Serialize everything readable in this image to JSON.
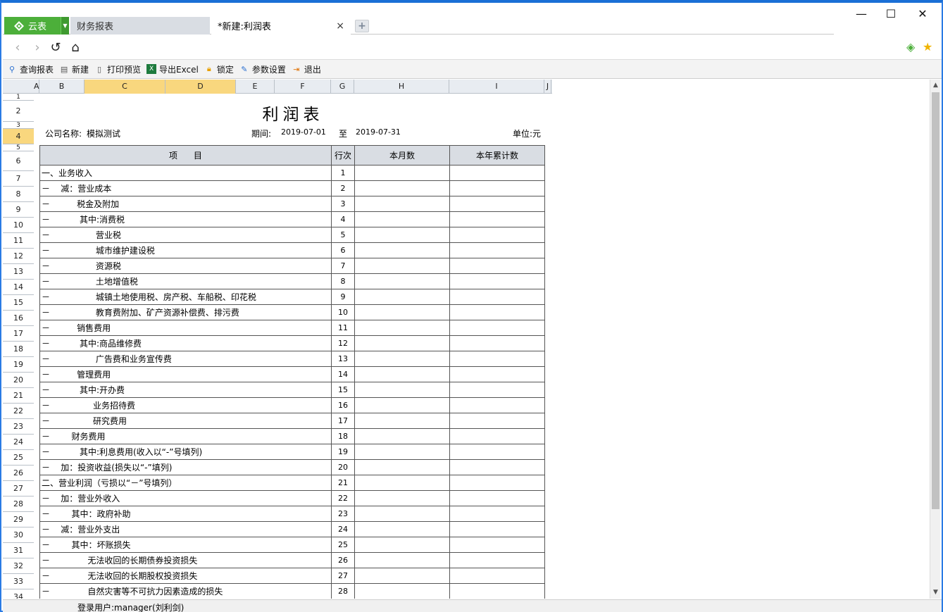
{
  "tabs": {
    "app_label": "云表",
    "tab1": "财务报表",
    "tab2": "*新建:利润表",
    "close": "×",
    "new_tab": "+"
  },
  "window": {
    "minimize": "—",
    "maximize": "☐",
    "close": "✕"
  },
  "toolbar": {
    "query": "查询报表",
    "new": "新建",
    "print_preview": "打印预览",
    "export": "导出Excel",
    "lock": "锁定",
    "params": "参数设置",
    "exit": "退出"
  },
  "columns": [
    "A",
    "B",
    "C",
    "D",
    "E",
    "F",
    "G",
    "H",
    "I",
    "J"
  ],
  "row_numbers": [
    "1",
    "2",
    "3",
    "4",
    "5",
    "6",
    "7",
    "8",
    "9",
    "10",
    "11",
    "12",
    "13",
    "14",
    "15",
    "16",
    "17",
    "18",
    "19",
    "20",
    "21",
    "22",
    "23",
    "24",
    "25",
    "26",
    "27",
    "28",
    "29",
    "30",
    "31",
    "32",
    "33",
    "34"
  ],
  "report": {
    "title": "利润表",
    "company_label": "公司名称:",
    "company": "模拟测试",
    "period_label": "期间:",
    "period_start": "2019-07-01",
    "to": "至",
    "period_end": "2019-07-31",
    "unit": "单位:元",
    "headers": {
      "item": "项      目",
      "line": "行次",
      "month": "本月数",
      "ytd": "本年累计数"
    },
    "rows": [
      {
        "item": "一、业务收入",
        "line": "1"
      },
      {
        "item": "－    减：营业成本",
        "line": "2"
      },
      {
        "item": "－          税金及附加",
        "line": "3"
      },
      {
        "item": "－           其中:消费税",
        "line": "4"
      },
      {
        "item": "－                 营业税",
        "line": "5"
      },
      {
        "item": "－                 城市维护建设税",
        "line": "6"
      },
      {
        "item": "－                 资源税",
        "line": "7"
      },
      {
        "item": "－                 土地增值税",
        "line": "8"
      },
      {
        "item": "－                 城镇土地使用税、房产税、车船税、印花税",
        "line": "9"
      },
      {
        "item": "－                 教育费附加、矿产资源补偿费、排污费",
        "line": "10"
      },
      {
        "item": "－          销售费用",
        "line": "11"
      },
      {
        "item": "－           其中:商品维修费",
        "line": "12"
      },
      {
        "item": "－                 广告费和业务宣传费",
        "line": "13"
      },
      {
        "item": "－          管理费用",
        "line": "14"
      },
      {
        "item": "－           其中:开办费",
        "line": "15"
      },
      {
        "item": "－                业务招待费",
        "line": "16"
      },
      {
        "item": "－                研究费用",
        "line": "17"
      },
      {
        "item": "－        财务费用",
        "line": "18"
      },
      {
        "item": "－           其中:利息费用(收入以“-”号填列)",
        "line": "19"
      },
      {
        "item": "－    加：投资收益(损失以“-”填列)",
        "line": "20"
      },
      {
        "item": "二、营业利润（亏损以“－”号填列）",
        "line": "21"
      },
      {
        "item": "－    加：营业外收入",
        "line": "22"
      },
      {
        "item": "－        其中：政府补助",
        "line": "23"
      },
      {
        "item": "－    减：营业外支出",
        "line": "24"
      },
      {
        "item": "－        其中：坏账损失",
        "line": "25"
      },
      {
        "item": "－              无法收回的长期债券投资损失",
        "line": "26"
      },
      {
        "item": "－              无法收回的长期股权投资损失",
        "line": "27"
      },
      {
        "item": "－              自然灾害等不可抗力因素造成的损失",
        "line": "28"
      }
    ]
  },
  "status": {
    "user": "登录用户:manager(刘利剑)"
  },
  "colors": {
    "accent": "#4caf3a",
    "selected_header": "#f9d77e",
    "window_border": "#2a7be4"
  }
}
